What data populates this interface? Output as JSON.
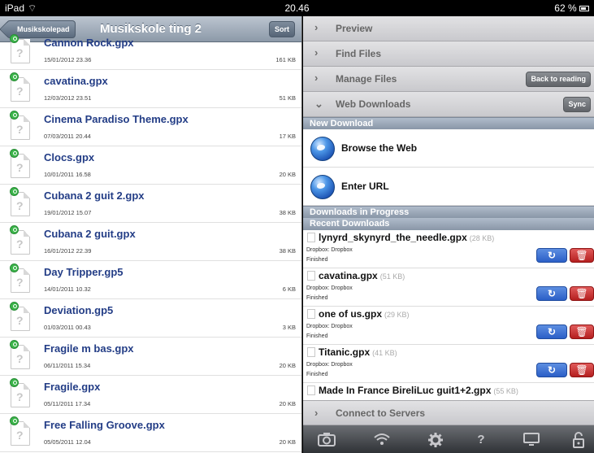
{
  "status_bar": {
    "device": "iPad",
    "wifi": "⌔",
    "time": "20.46",
    "battery": "62 %"
  },
  "left": {
    "back_label": "Musikskolepad",
    "title": "Musikskole ting 2",
    "sort_label": "Sort",
    "files": [
      {
        "name": "Cannon Rock.gpx",
        "date": "15/01/2012 23.36",
        "size": "161 KB"
      },
      {
        "name": "cavatina.gpx",
        "date": "12/03/2012 23.51",
        "size": "51 KB"
      },
      {
        "name": "Cinema Paradiso Theme.gpx",
        "date": "07/03/2011 20.44",
        "size": "17 KB"
      },
      {
        "name": "Clocs.gpx",
        "date": "10/01/2011 16.58",
        "size": "20 KB"
      },
      {
        "name": "Cubana 2 guit 2.gpx",
        "date": "19/01/2012 15.07",
        "size": "38 KB"
      },
      {
        "name": "Cubana 2 guit.gpx",
        "date": "16/01/2012 22.39",
        "size": "38 KB"
      },
      {
        "name": "Day Tripper.gp5",
        "date": "14/01/2011 10.32",
        "size": "6 KB"
      },
      {
        "name": "Deviation.gp5",
        "date": "01/03/2011 00.43",
        "size": "3 KB"
      },
      {
        "name": "Fragile m bas.gpx",
        "date": "06/11/2011 15.34",
        "size": "20 KB"
      },
      {
        "name": "Fragile.gpx",
        "date": "05/11/2011 17.34",
        "size": "20 KB"
      },
      {
        "name": "Free Falling Groove.gpx",
        "date": "05/05/2011 12.04",
        "size": "20 KB"
      }
    ]
  },
  "right": {
    "preview_label": "Preview",
    "find_files_label": "Find Files",
    "manage_files_label": "Manage Files",
    "back_to_reading_label": "Back to reading",
    "web_downloads_label": "Web Downloads",
    "sync_label": "Sync",
    "new_download_header": "New Download",
    "browse_web_label": "Browse the Web",
    "enter_url_label": "Enter URL",
    "in_progress_header": "Downloads in Progress",
    "recent_header": "Recent Downloads",
    "downloads": [
      {
        "name": "lynyrd_skynyrd_the_needle.gpx",
        "size": "(28 KB)",
        "source": "Dropbox: Dropbox",
        "status": "Finished"
      },
      {
        "name": "cavatina.gpx",
        "size": "(51 KB)",
        "source": "Dropbox: Dropbox",
        "status": "Finished"
      },
      {
        "name": "one of us.gpx",
        "size": "(29 KB)",
        "source": "Dropbox: Dropbox",
        "status": "Finished"
      },
      {
        "name": "Titanic.gpx",
        "size": "(41 KB)",
        "source": "Dropbox: Dropbox",
        "status": "Finished"
      },
      {
        "name": "Made In France BireliLuc guit1+2.gpx",
        "size": "(55 KB)"
      }
    ],
    "connect_label": "Connect to Servers",
    "tabs": {
      "camera": "camera-icon",
      "wifi": "wifi-icon",
      "settings": "gear-icon",
      "help": "?",
      "screen": "screen-icon",
      "lock": "lock-icon"
    }
  }
}
